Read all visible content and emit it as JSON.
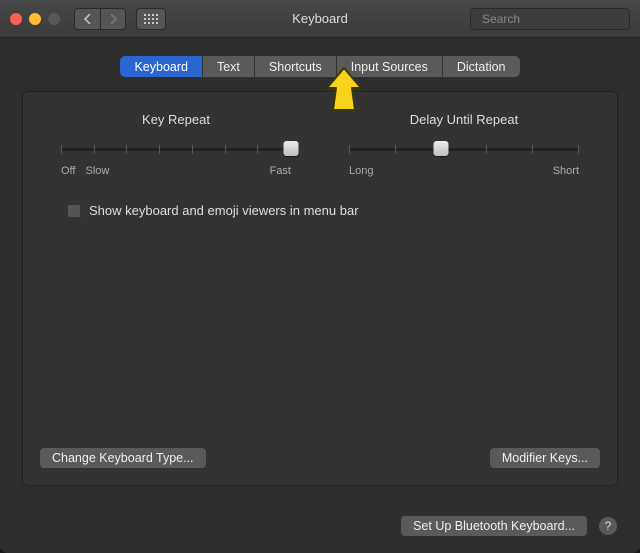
{
  "window": {
    "title": "Keyboard"
  },
  "search": {
    "placeholder": "Search"
  },
  "tabs": [
    {
      "label": "Keyboard",
      "active": true
    },
    {
      "label": "Text"
    },
    {
      "label": "Shortcuts"
    },
    {
      "label": "Input Sources"
    },
    {
      "label": "Dictation"
    }
  ],
  "sliders": {
    "key_repeat": {
      "label": "Key Repeat",
      "ticks": 8,
      "value_index": 7,
      "scale_left": [
        "Off",
        "Slow"
      ],
      "scale_right": "Fast"
    },
    "delay": {
      "label": "Delay Until Repeat",
      "ticks": 6,
      "value_index": 2,
      "scale_left": [
        "Long"
      ],
      "scale_right": "Short"
    }
  },
  "checkbox": {
    "show_emoji_viewers": {
      "label": "Show keyboard and emoji viewers in menu bar",
      "checked": false
    }
  },
  "buttons": {
    "change_type": "Change Keyboard Type...",
    "modifier": "Modifier Keys...",
    "bluetooth": "Set Up Bluetooth Keyboard...",
    "help": "?"
  }
}
